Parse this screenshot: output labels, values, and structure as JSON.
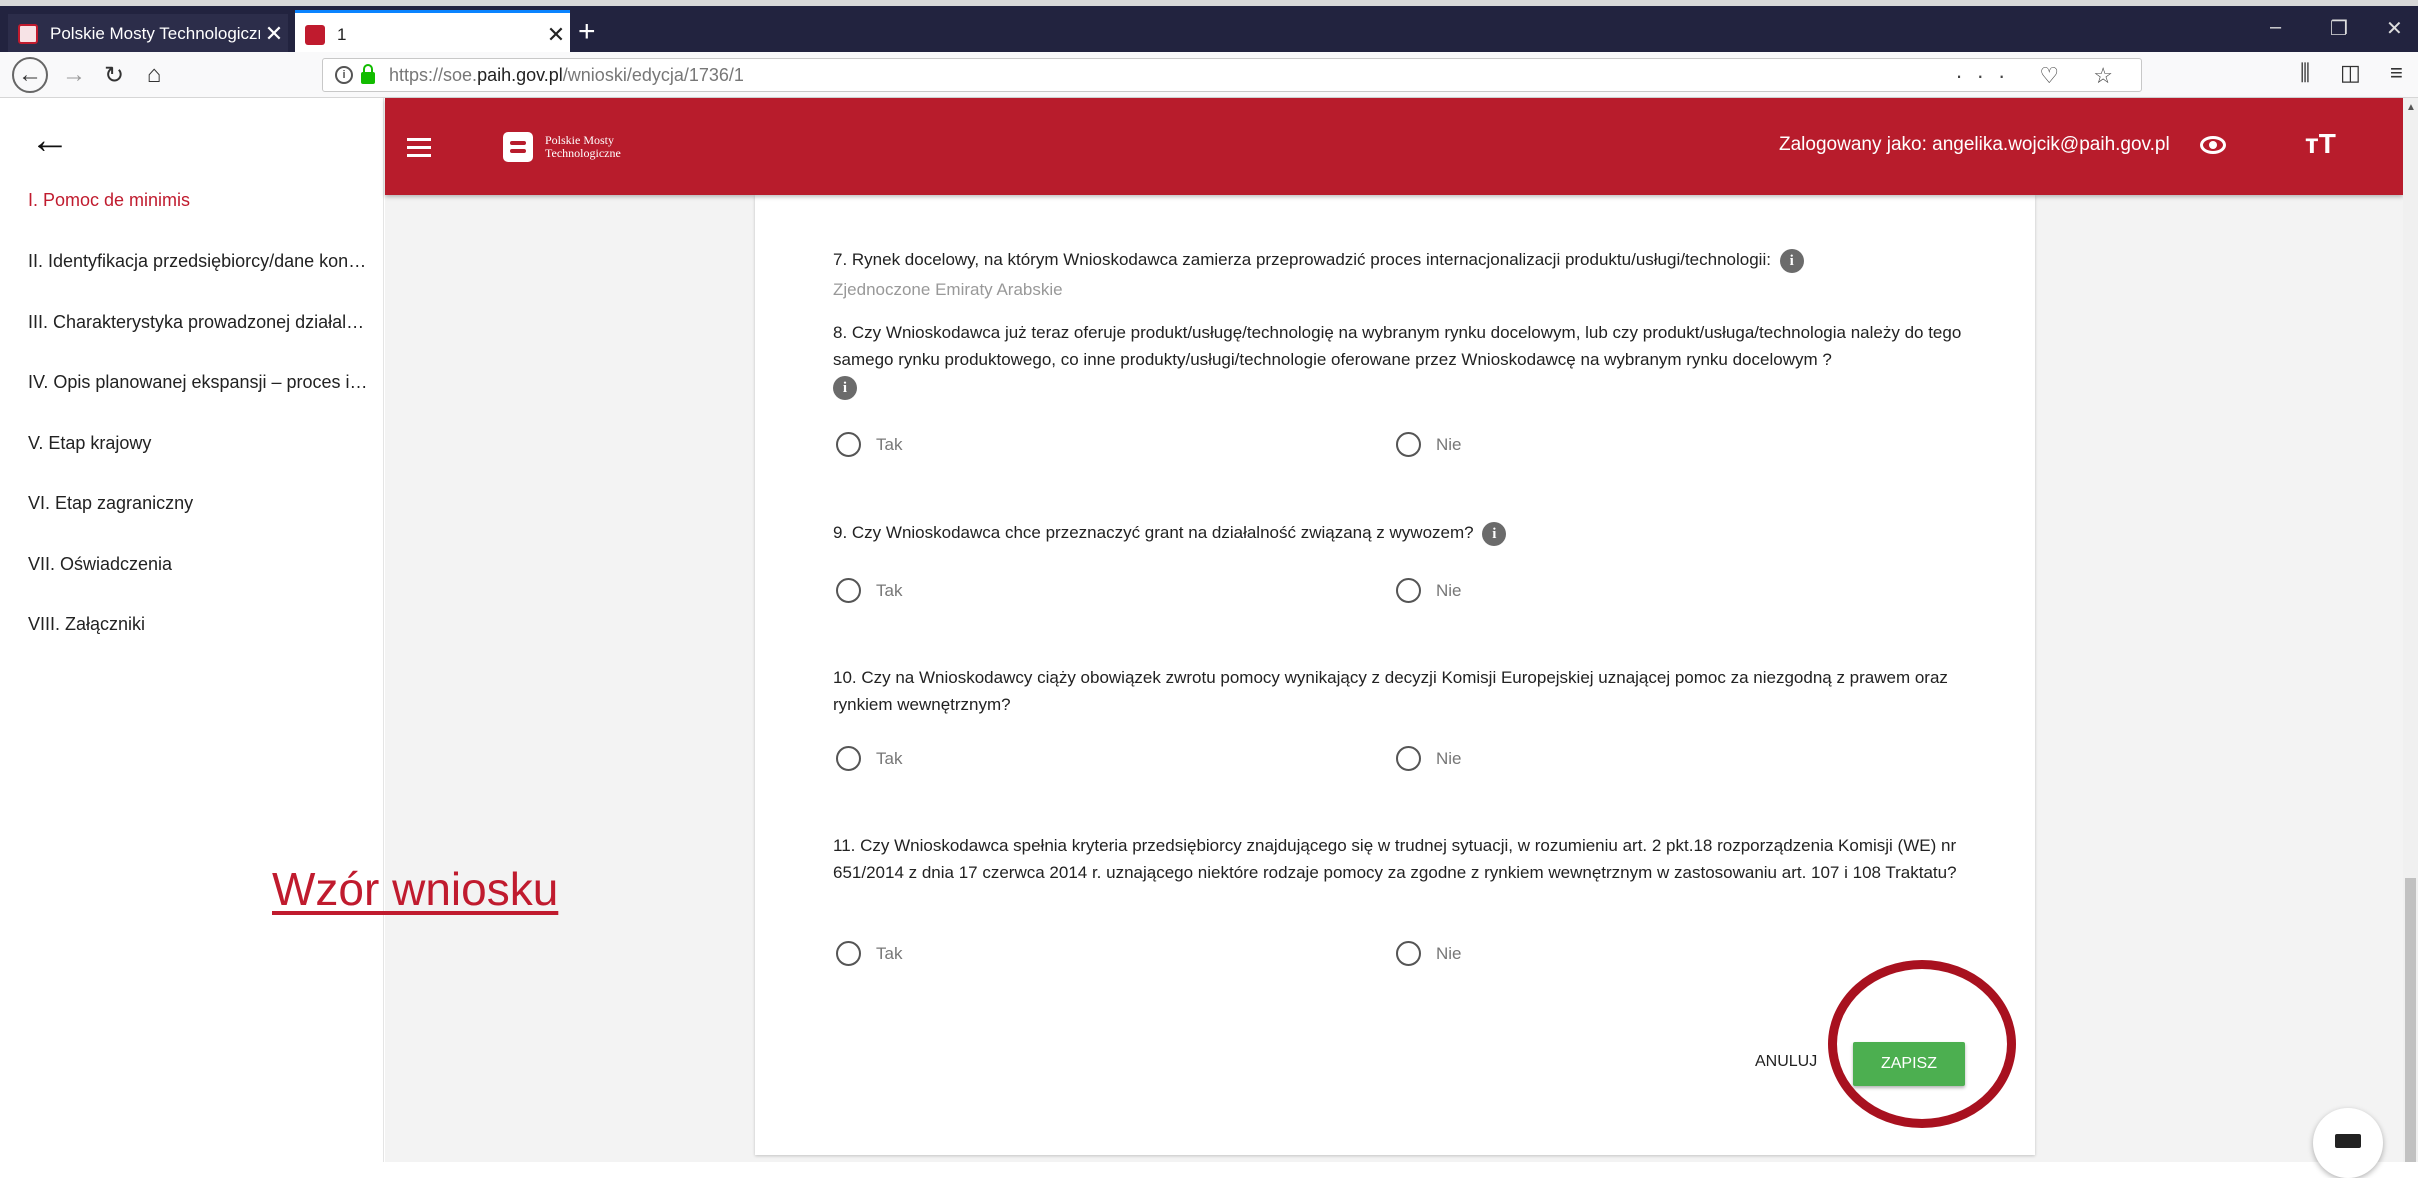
{
  "browser": {
    "tabs": [
      {
        "title": "Polskie Mosty Technologiczne",
        "close": "✕"
      },
      {
        "title": "1",
        "close": "✕"
      }
    ],
    "new_tab": "+",
    "url_prefix": "https://soe.",
    "url_domain": "paih.gov.pl",
    "url_path": "/wnioski/edycja/1736/1",
    "url_right_icons": "··· ♡ ☆",
    "window_controls": [
      "–",
      "❐",
      "✕"
    ]
  },
  "sidebar": {
    "items": [
      {
        "label": "I. Pomoc de minimis",
        "active": true
      },
      {
        "label": "II. Identyfikacja przedsiębiorcy/dane kontaktowe"
      },
      {
        "label": "III. Charakterystyka prowadzonej działalności"
      },
      {
        "label": "IV. Opis planowanej ekspansji – proces internacjonalizacji"
      },
      {
        "label": "V. Etap krajowy"
      },
      {
        "label": "VI. Etap zagraniczny"
      },
      {
        "label": "VII. Oświadczenia"
      },
      {
        "label": "VIII. Załączniki"
      }
    ]
  },
  "header": {
    "logo_line1": "Polskie Mosty",
    "logo_line2": "Technologiczne",
    "user": "Zalogowany jako: angelika.wojcik@paih.gov.pl",
    "text_size_icon": "тT"
  },
  "form": {
    "q7": "7.  Rynek docelowy, na którym Wnioskodawca zamierza przeprowadzić proces internacjonalizacji produktu/usługi/technologii:",
    "q7_answer": "Zjednoczone Emiraty Arabskie",
    "q8": "8.  Czy Wnioskodawca już teraz oferuje produkt/usługę/technologię na wybranym rynku docelowym, lub czy produkt/usługa/technologia należy do tego samego rynku produktowego, co inne produkty/usługi/technologie oferowane przez Wnioskodawcę na wybranym rynku docelowym ?",
    "q9": "9.  Czy Wnioskodawca chce przeznaczyć grant na działalność związaną z wywozem?",
    "q10": "10.  Czy na Wnioskodawcy ciąży obowiązek zwrotu pomocy wynikający z decyzji Komisji Europejskiej uznającej pomoc za niezgodną z prawem oraz rynkiem wewnętrznym?",
    "q11": "11.  Czy Wnioskodawca spełnia kryteria przedsiębiorcy znajdującego się w trudnej sytuacji, w rozumieniu art. 2 pkt.18 rozporządzenia Komisji (WE) nr 651/2014 z dnia 17 czerwca 2014 r. uznającego niektóre rodzaje pomocy za zgodne z rynkiem wewnętrznym w zastosowaniu art. 107 i 108 Traktatu?",
    "info_glyph": "i",
    "yes": "Tak",
    "no": "Nie",
    "cancel": "ANULUJ",
    "save": "ZAPISZ"
  },
  "overlay": {
    "watermark": "Wzór wniosku"
  }
}
